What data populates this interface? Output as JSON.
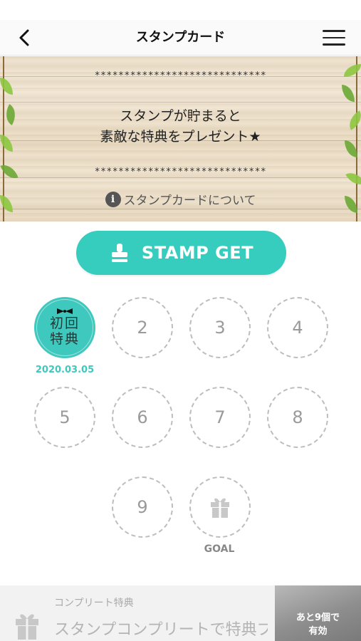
{
  "header": {
    "title": "スタンプカード"
  },
  "banner": {
    "stars_top": "*****************************",
    "message_line1": "スタンプが貯まると",
    "message_line2": "素敵な特典をプレゼント★",
    "stars_bottom": "*****************************",
    "about_link": "スタンプカードについて"
  },
  "stamp_button": {
    "label": "STAMP GET",
    "color": "#36cdbf"
  },
  "stamps": {
    "first": {
      "text": "初回特典",
      "date": "2020.03.05"
    },
    "slots": [
      "2",
      "3",
      "4",
      "5",
      "6",
      "7",
      "8",
      "9"
    ],
    "goal_label": "GOAL"
  },
  "footer": {
    "label": "コンプリート特典",
    "text": "スタンプコンプリートで特典プ",
    "remaining_line1": "あと9個で",
    "remaining_line2": "有効"
  },
  "colors": {
    "accent": "#36cdbf",
    "slot_border": "#bdbdbd"
  }
}
